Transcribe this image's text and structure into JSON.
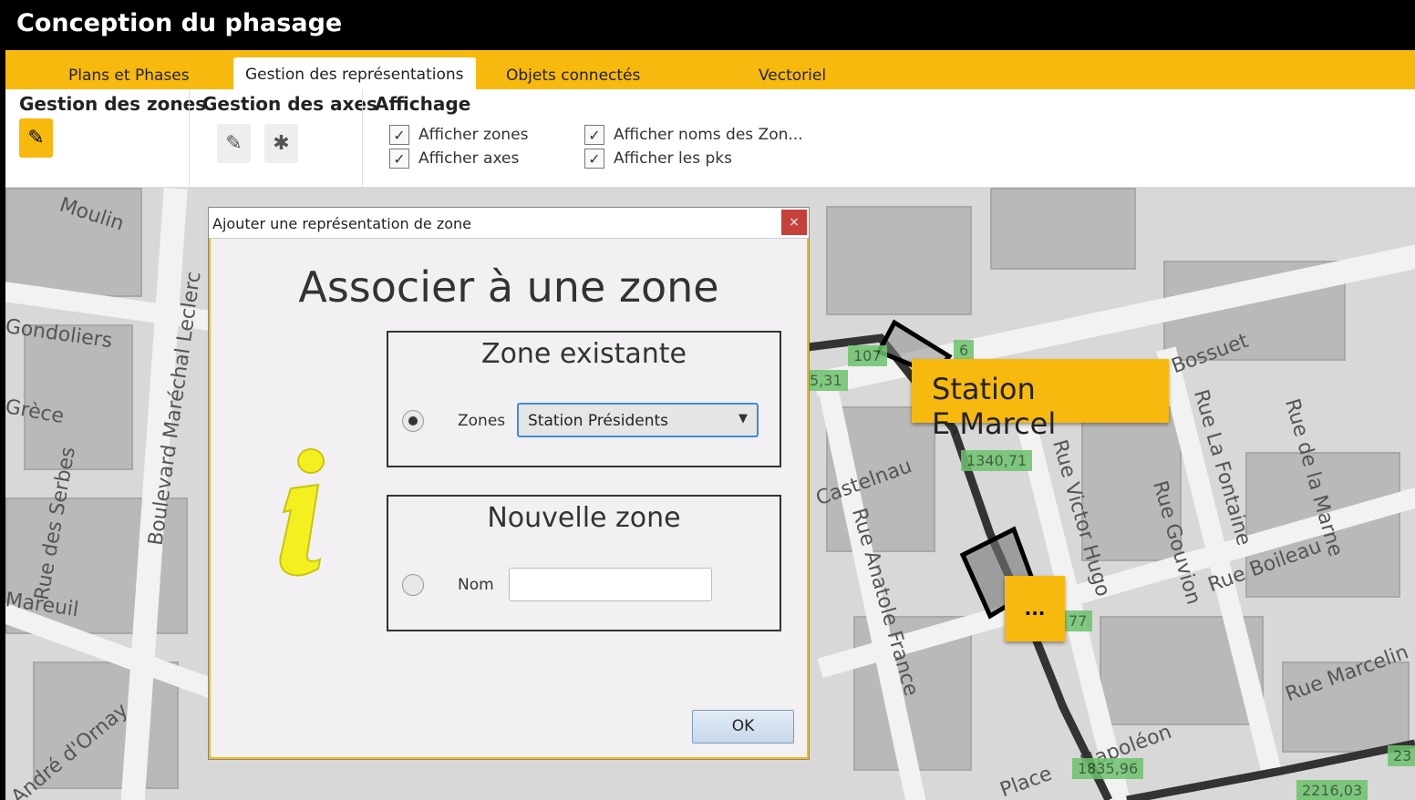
{
  "app": {
    "title": "Conception du phasage"
  },
  "tabs": [
    {
      "label": "Plans et Phases"
    },
    {
      "label": "Gestion des représentations"
    },
    {
      "label": "Objets connectés"
    },
    {
      "label": "Vectoriel"
    }
  ],
  "ribbon": {
    "zones_group": "Gestion des zones",
    "axes_group": "Gestion des axes",
    "display_group": "Affichage",
    "checks": [
      {
        "label": "Afficher zones",
        "checked": true
      },
      {
        "label": "Afficher axes",
        "checked": true
      },
      {
        "label": "Afficher noms des Zon...",
        "checked": true
      },
      {
        "label": "Afficher les pks",
        "checked": true
      }
    ]
  },
  "map": {
    "streets": [
      "Moulin",
      "Gondoliers",
      "Grèce",
      "Rue des Serbes",
      "Mareuil",
      "Boulevard Maréchal Leclerc",
      "André d'Ornay",
      "Castelnau",
      "Rue Anatole France",
      "Rue Victor Hugo",
      "Rue Gouvion",
      "Rue La Fontaine",
      "Rue de la Marne",
      "Rue Boileau",
      "Rue Marcelin",
      "Bossuet",
      "Place",
      "Napoléon"
    ],
    "pk_labels": [
      "107",
      "6",
      "5,31",
      "1340,71",
      "77",
      "1835,96",
      "2216,03",
      "23"
    ],
    "station_label": "Station E.Marcel",
    "ellipsis_label": "..."
  },
  "dialog": {
    "title": "Ajouter une représentation de zone",
    "close": "×",
    "heading": "Associer à une zone",
    "existing": {
      "title": "Zone existante",
      "field_label": "Zones",
      "selected": "Station Présidents",
      "selected_flag": true
    },
    "new": {
      "title": "Nouvelle zone",
      "field_label": "Nom",
      "value": ""
    },
    "ok": "OK"
  }
}
